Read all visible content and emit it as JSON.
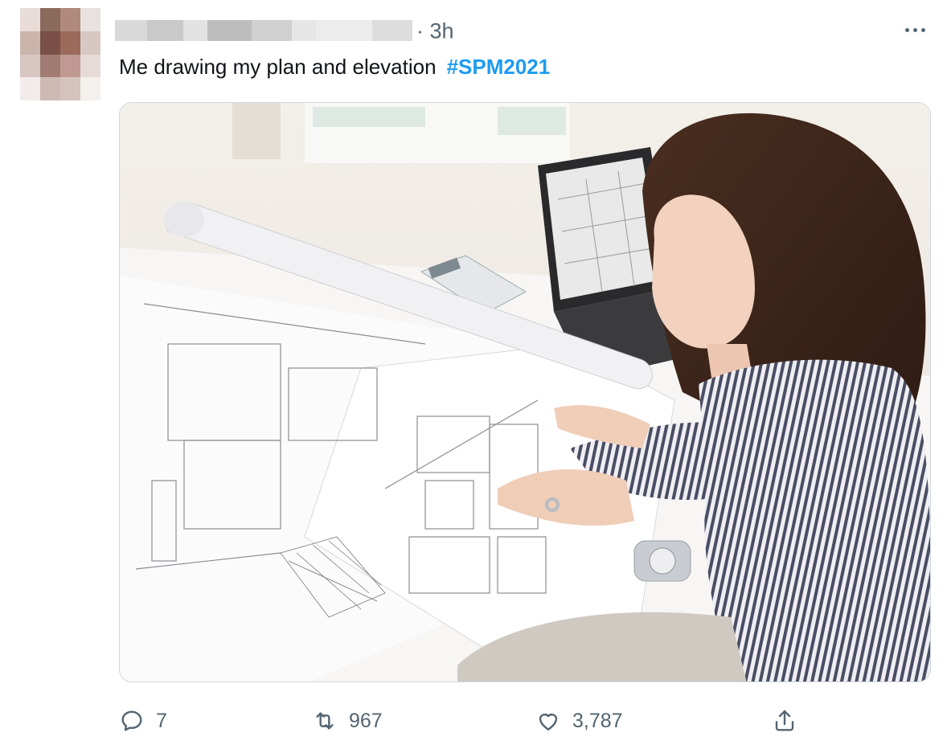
{
  "tweet": {
    "timestamp": "3h",
    "text": "Me drawing my plan and elevation",
    "hashtag": "#SPM2021",
    "more_icon": "more-horizontal-icon"
  },
  "media": {
    "type": "photo"
  },
  "actions": {
    "reply_count": "7",
    "retweet_count": "967",
    "like_count": "3,787",
    "reply_icon": "reply-icon",
    "retweet_icon": "retweet-icon",
    "like_icon": "heart-icon",
    "share_icon": "share-icon"
  },
  "colors": {
    "link": "#1d9bf0",
    "secondary_text": "#536471",
    "border": "#cfd9de"
  }
}
